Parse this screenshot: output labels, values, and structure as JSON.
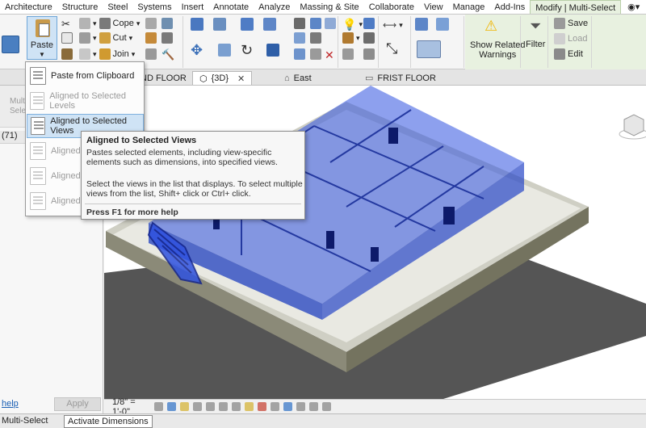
{
  "ribbon_tabs": [
    "Architecture",
    "Structure",
    "Steel",
    "Systems",
    "Insert",
    "Annotate",
    "Analyze",
    "Massing & Site",
    "Collaborate",
    "View",
    "Manage",
    "Add-Ins",
    "Modify | Multi-Select"
  ],
  "active_tab": "Modify | Multi-Select",
  "ribbon": {
    "paste_label": "Paste",
    "cope_label": "Cope",
    "cut_label": "Cut",
    "join_label": "Join",
    "show_related_warnings_line1": "Show Related",
    "show_related_warnings_line2": "Warnings",
    "filter_label": "Filter",
    "save_label": "Save",
    "load_label": "Load",
    "edit_label": "Edit"
  },
  "view_tabs": [
    {
      "label": "ND FLOOR",
      "active": false
    },
    {
      "label": "{3D}",
      "active": true
    },
    {
      "label": "East",
      "active": false
    },
    {
      "label": "FRIST FLOOR",
      "active": false
    }
  ],
  "paste_menu": {
    "items": [
      {
        "label": "Paste from Clipboard",
        "enabled": true
      },
      {
        "label": "Aligned to Selected Levels",
        "enabled": false
      },
      {
        "label": "Aligned to Selected Views",
        "enabled": true,
        "highlighted": true
      },
      {
        "label": "Aligned t",
        "enabled": false
      },
      {
        "label": "Aligned t",
        "enabled": false
      },
      {
        "label": "Aligned t",
        "enabled": false
      }
    ]
  },
  "tooltip": {
    "title": "Aligned to Selected Views",
    "description": "Pastes selected elements, including view-specific elements such as dimensions, into specified views.",
    "instructions": "Select the views in the list that displays. To select multiple views from the list, Shift+ click or Ctrl+ click.",
    "help": "Press F1 for more help"
  },
  "properties": {
    "header_label_line1": "Multi",
    "header_label_line2": "Select",
    "count": "(71)",
    "help_link": "help",
    "apply_label": "Apply"
  },
  "view_bar": {
    "scale": "1/8\" = 1'-0\""
  },
  "status": {
    "text": "Multi-Select",
    "tooltip": "Activate Dimensions"
  },
  "colors": {
    "selection_blue": "#2f52e0",
    "context_tab_green": "#e8f1e0",
    "highlight_blue": "#cfe3f5"
  }
}
